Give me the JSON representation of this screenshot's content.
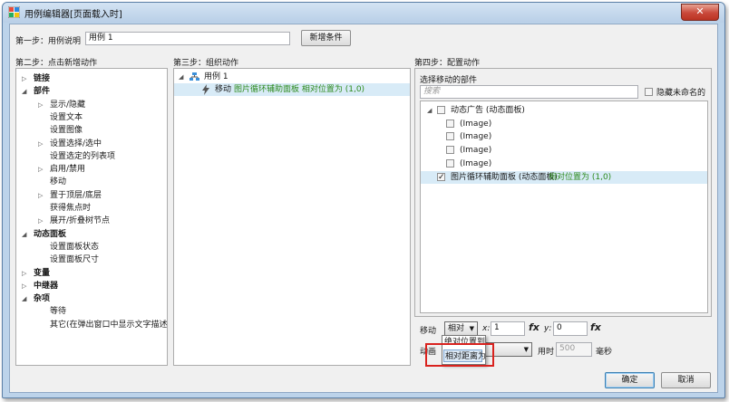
{
  "window": {
    "title": "用例编辑器[页面载入时]",
    "close_glyph": "✕"
  },
  "step1": {
    "label": "第一步：用例说明",
    "value": "用例 1",
    "add_condition_label": "新增条件"
  },
  "step2": {
    "label": "第二步：点击新增动作",
    "items": [
      {
        "label": "链接",
        "level": 0,
        "bold": true,
        "arrow": "▷"
      },
      {
        "label": "部件",
        "level": 0,
        "bold": true,
        "arrow": "◢"
      },
      {
        "label": "显示/隐藏",
        "level": 1,
        "arrow": "▷"
      },
      {
        "label": "设置文本",
        "level": 1,
        "arrow": ""
      },
      {
        "label": "设置图像",
        "level": 1,
        "arrow": ""
      },
      {
        "label": "设置选择/选中",
        "level": 1,
        "arrow": "▷"
      },
      {
        "label": "设置选定的列表项",
        "level": 1,
        "arrow": ""
      },
      {
        "label": "启用/禁用",
        "level": 1,
        "arrow": "▷"
      },
      {
        "label": "移动",
        "level": 1,
        "arrow": ""
      },
      {
        "label": "置于顶层/底层",
        "level": 1,
        "arrow": "▷"
      },
      {
        "label": "获得焦点时",
        "level": 1,
        "arrow": ""
      },
      {
        "label": "展开/折叠树节点",
        "level": 1,
        "arrow": "▷"
      },
      {
        "label": "动态面板",
        "level": 0,
        "bold": true,
        "arrow": "◢"
      },
      {
        "label": "设置面板状态",
        "level": 1,
        "arrow": ""
      },
      {
        "label": "设置面板尺寸",
        "level": 1,
        "arrow": ""
      },
      {
        "label": "变量",
        "level": 0,
        "bold": true,
        "arrow": "▷"
      },
      {
        "label": "中继器",
        "level": 0,
        "bold": true,
        "arrow": "▷"
      },
      {
        "label": "杂项",
        "level": 0,
        "bold": true,
        "arrow": "◢"
      },
      {
        "label": "等待",
        "level": 1,
        "arrow": ""
      },
      {
        "label": "其它(在弹出窗口中显示文字描述)",
        "level": 1,
        "arrow": ""
      }
    ]
  },
  "step3": {
    "label": "第三步：组织动作",
    "case_label": "用例 1",
    "action_prefix": "移动",
    "action_target": "图片循环辅助面板 相对位置为 (1,0)"
  },
  "step4": {
    "label": "第四步：配置动作",
    "select_label": "选择移动的部件",
    "search_placeholder": "搜索",
    "hide_unnamed_label": "隐藏未命名的",
    "widgets": [
      {
        "label": "动态广告 (动态面板)",
        "level": 0,
        "checked": false,
        "arrow": "◢",
        "selected": false
      },
      {
        "label": "(Image)",
        "level": 1,
        "checked": false,
        "selected": false
      },
      {
        "label": "(Image)",
        "level": 1,
        "checked": false,
        "selected": false
      },
      {
        "label": "(Image)",
        "level": 1,
        "checked": false,
        "selected": false
      },
      {
        "label": "(Image)",
        "level": 1,
        "checked": false,
        "selected": false
      },
      {
        "label": "图片循环辅助面板 (动态面板)",
        "suffix": "相对位置为 (1,0)",
        "level": 0,
        "checked": true,
        "selected": true
      }
    ],
    "move_label": "移动",
    "move_mode": "相对",
    "x_label": "x:",
    "x_value": "1",
    "y_label": "y:",
    "y_value": "0",
    "fx_label": "fx",
    "animation_label": "动画",
    "time_label": "用时",
    "time_value": "500",
    "time_unit": "毫秒",
    "dropdown_options": [
      "绝对位置到",
      "相对距离为"
    ],
    "highlighted_option": "相对距离为"
  },
  "footer": {
    "ok_label": "确定",
    "cancel_label": "取消"
  },
  "colors": {
    "accent_red": "#d9221e",
    "selection": "#d8ebf7",
    "green_text": "#2e8b1e"
  }
}
